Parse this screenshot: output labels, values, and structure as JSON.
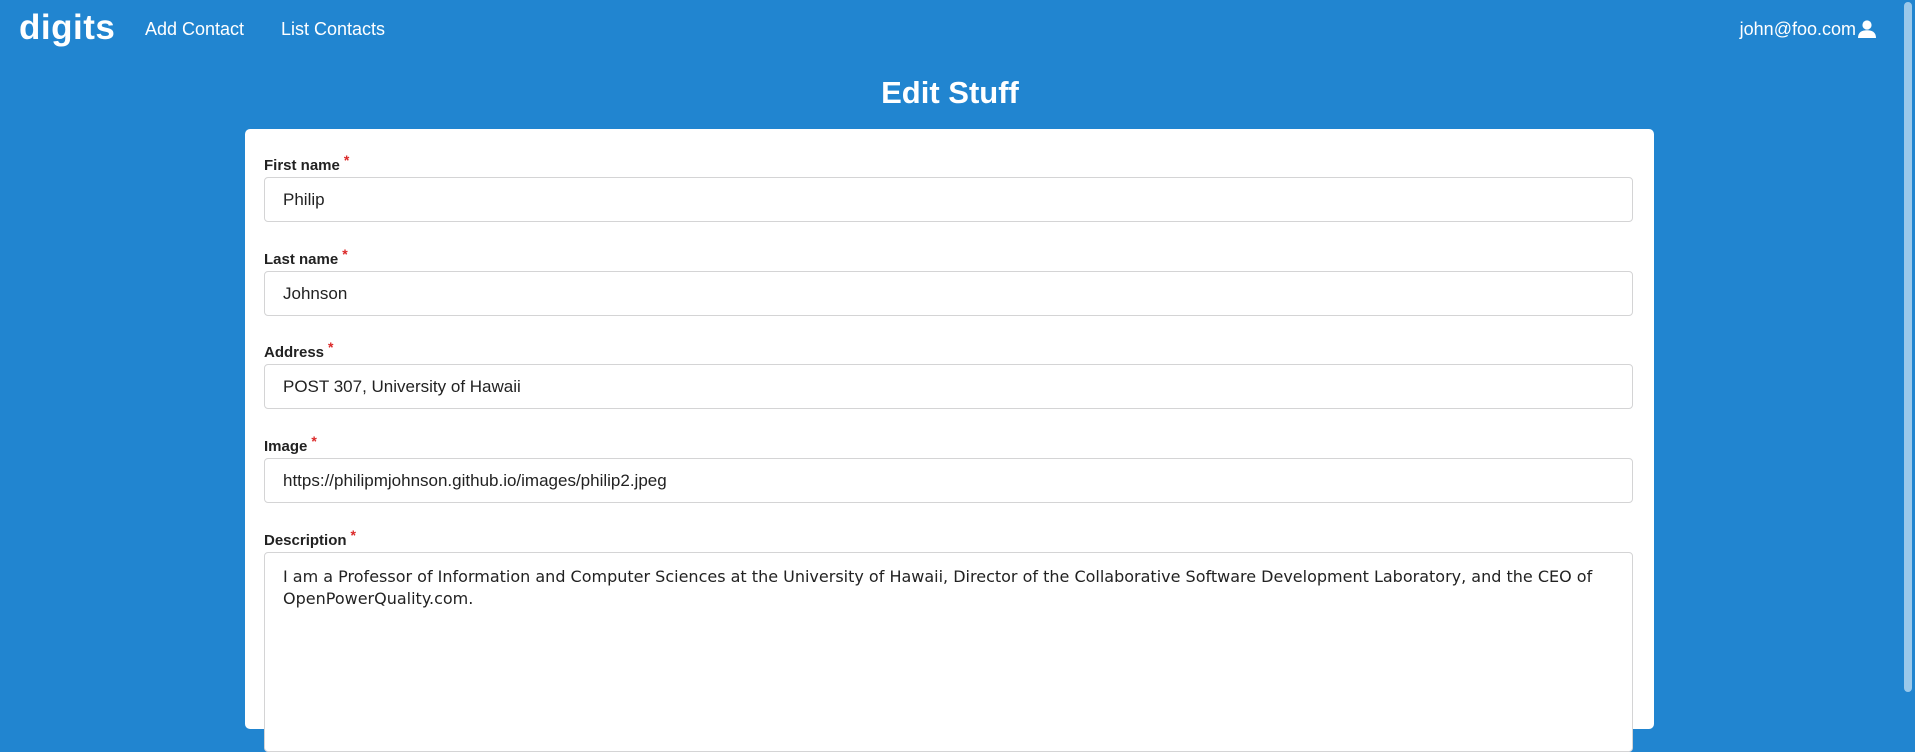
{
  "navbar": {
    "brand": "digits",
    "links": [
      "Add Contact",
      "List Contacts"
    ],
    "user_email": "john@foo.com",
    "user_icon": "user-icon"
  },
  "page": {
    "title": "Edit Stuff"
  },
  "form": {
    "required_marker": "*",
    "first_name": {
      "label": "First name",
      "value": "Philip"
    },
    "last_name": {
      "label": "Last name",
      "value": "Johnson"
    },
    "address": {
      "label": "Address",
      "value": "POST 307, University of Hawaii"
    },
    "image": {
      "label": "Image",
      "value": "https://philipmjohnson.github.io/images/philip2.jpeg"
    },
    "description": {
      "label": "Description",
      "value": "I am a Professor of Information and Computer Sciences at the University of Hawaii, Director of the Collaborative Software Development Laboratory, and the CEO of OpenPowerQuality.com."
    }
  },
  "colors": {
    "background": "#2185d0",
    "required": "#db2828"
  }
}
